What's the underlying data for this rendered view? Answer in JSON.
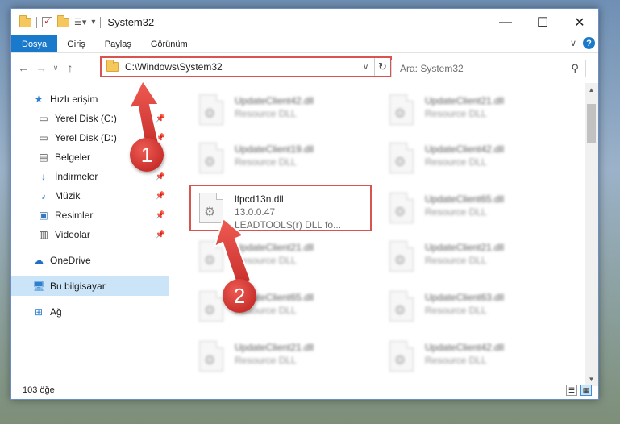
{
  "window": {
    "title": "System32"
  },
  "controls": {
    "minimize": "—",
    "maximize": "☐",
    "close": "✕"
  },
  "ribbon": {
    "tabs": [
      "Dosya",
      "Giriş",
      "Paylaş",
      "Görünüm"
    ]
  },
  "address": {
    "path": "C:\\Windows\\System32"
  },
  "search": {
    "placeholder": "Ara: System32"
  },
  "nav": {
    "quick_access": "Hızlı erişim",
    "items": [
      {
        "label": "Yerel Disk (C:)",
        "icon": "drive-icon"
      },
      {
        "label": "Yerel Disk (D:)",
        "icon": "drive-icon"
      },
      {
        "label": "Belgeler",
        "icon": "documents-icon"
      },
      {
        "label": "İndirmeler",
        "icon": "downloads-icon"
      },
      {
        "label": "Müzik",
        "icon": "music-icon"
      },
      {
        "label": "Resimler",
        "icon": "pictures-icon"
      },
      {
        "label": "Videolar",
        "icon": "videos-icon"
      }
    ],
    "onedrive": "OneDrive",
    "this_pc": "Bu bilgisayar",
    "network": "Ağ"
  },
  "files": [
    {
      "name": "UpdateClient42.dll",
      "sub": "Resource DLL"
    },
    {
      "name": "UpdateClient21.dll",
      "sub": "Resource DLL"
    },
    {
      "name": "UpdateClient19.dll",
      "sub": "Resource DLL"
    },
    {
      "name": "UpdateClient42.dll",
      "sub": "Resource DLL"
    },
    {
      "name": "lfpcd13n.dll",
      "version": "13.0.0.47",
      "desc": "LEADTOOLS(r) DLL fo..."
    },
    {
      "name": "UpdateClient65.dll",
      "sub": "Resource DLL"
    },
    {
      "name": "UpdateClient21.dll",
      "sub": "Resource DLL"
    },
    {
      "name": "UpdateClient21.dll",
      "sub": "Resource DLL"
    },
    {
      "name": "UpdateClient65.dll",
      "sub": "Resource DLL"
    },
    {
      "name": "UpdateClient63.dll",
      "sub": "Resource DLL"
    },
    {
      "name": "UpdateClient21.dll",
      "sub": "Resource DLL"
    },
    {
      "name": "UpdateClient42.dll",
      "sub": "Resource DLL"
    }
  ],
  "status": {
    "count": "103 öğe"
  },
  "annotations": {
    "step1": "1",
    "step2": "2"
  },
  "colors": {
    "accent": "#1979ca",
    "highlight": "#d9534f",
    "selected": "#cce4f7"
  }
}
